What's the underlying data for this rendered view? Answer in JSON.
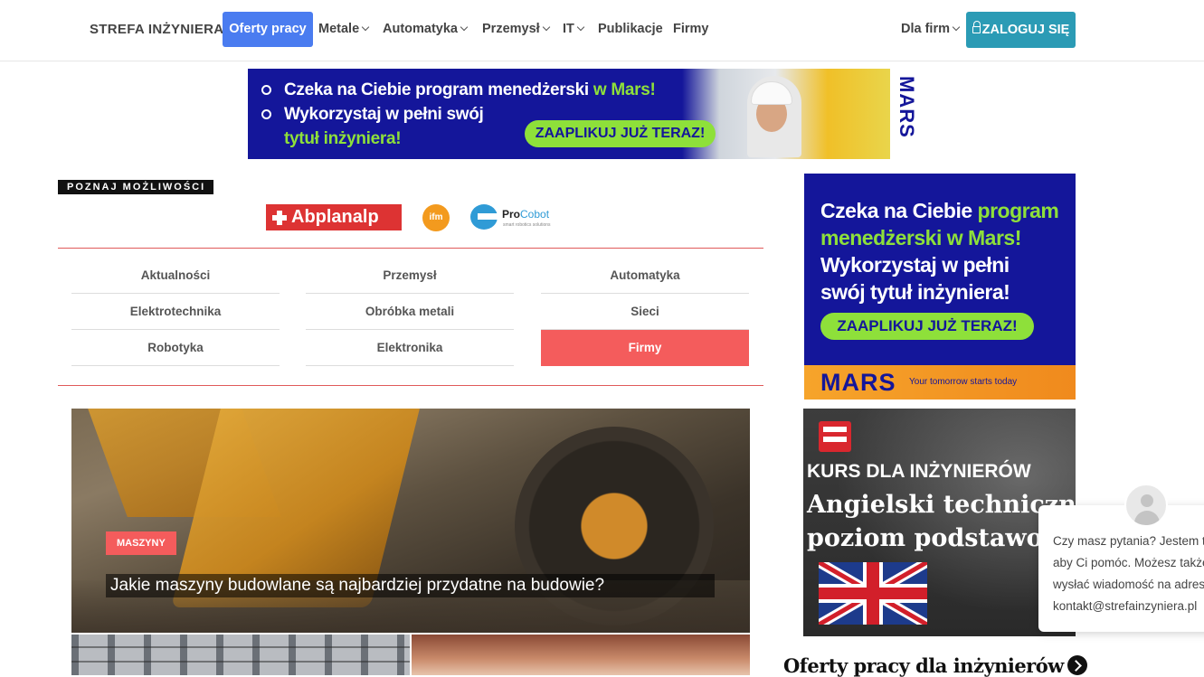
{
  "nav": {
    "brand": "STREFA INŻYNIERA",
    "active": "Oferty pracy",
    "items": [
      {
        "label": "Metale"
      },
      {
        "label": "Automatyka"
      },
      {
        "label": "Przemysł"
      },
      {
        "label": "IT"
      },
      {
        "label": "Publikacje"
      },
      {
        "label": "Firmy"
      }
    ],
    "for_companies": "Dla firm",
    "login": "ZALOGUJ SIĘ"
  },
  "top_banner": {
    "line1_white": "Czeka na Ciebie program menedżerski",
    "line1_green": "w Mars!",
    "line2": "Wykorzystaj w pełni swój",
    "line3": "tytuł inżyniera!",
    "cta": "ZAAPLIKUJ JUŻ TERAZ!",
    "brand": "MARS"
  },
  "partners": {
    "heading": "POZNAJ MOŻLIWOŚCI",
    "abplanalp": "Abplanalp",
    "ifm": "ifm",
    "procobot_a": "Pro",
    "procobot_b": "Cobot",
    "procobot_sub": "smart robotics solutions"
  },
  "categories": [
    {
      "label": "Aktualności"
    },
    {
      "label": "Przemysł"
    },
    {
      "label": "Automatyka"
    },
    {
      "label": "Elektrotechnika"
    },
    {
      "label": "Obróbka metali"
    },
    {
      "label": "Sieci"
    },
    {
      "label": "Robotyka"
    },
    {
      "label": "Elektronika"
    },
    {
      "label": "Firmy"
    }
  ],
  "featured": {
    "badge": "MASZYNY",
    "title": "Jakie maszyny budowlane są najbardziej przydatne na budowie?"
  },
  "side_ad": {
    "l1_white": "Czeka na Ciebie",
    "l1_green": "program",
    "l2_green": "menedżerski w Mars!",
    "l3": "Wykorzystaj w pełni",
    "l4": "swój tytuł inżyniera!",
    "cta": "ZAAPLIKUJ JUŻ TERAZ!",
    "brand": "MARS",
    "tagline": "Your tomorrow starts today"
  },
  "course": {
    "kicker": "KURS DLA INŻYNIERÓW",
    "title1": "Angielski techniczny",
    "title2": "poziom podstawowy"
  },
  "offers_heading": "Oferty pracy dla inżynierów",
  "chat": {
    "line1": "Czy masz pytania? Jestem tu,",
    "line2": "aby Ci pomóc. Możesz także",
    "line3": "wysłać wiadomość na adres",
    "line4": "kontakt@strefainzyniera.pl"
  }
}
